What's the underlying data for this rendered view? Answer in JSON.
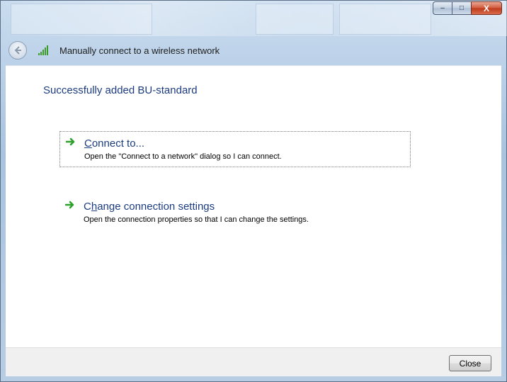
{
  "window": {
    "title": "Manually connect to a wireless network",
    "controls": {
      "minimize": "–",
      "maximize": "□",
      "close": "X"
    }
  },
  "header": {
    "back_icon": "back-arrow-icon",
    "network_icon": "wireless-signal-icon",
    "title": "Manually connect to a wireless network"
  },
  "main": {
    "heading": "Successfully added BU-standard",
    "options": [
      {
        "title_first": "C",
        "title_rest": "onnect to...",
        "description": "Open the \"Connect to a network\" dialog so I can connect.",
        "icon": "green-arrow-icon"
      },
      {
        "title_first": "C",
        "title_mid": "h",
        "title_rest": "ange connection settings",
        "description": "Open the connection properties so that I can change the settings.",
        "icon": "green-arrow-icon"
      }
    ]
  },
  "footer": {
    "close_label": "Close"
  },
  "colors": {
    "link_blue": "#1c3c80",
    "arrow_green": "#2ea02b"
  }
}
